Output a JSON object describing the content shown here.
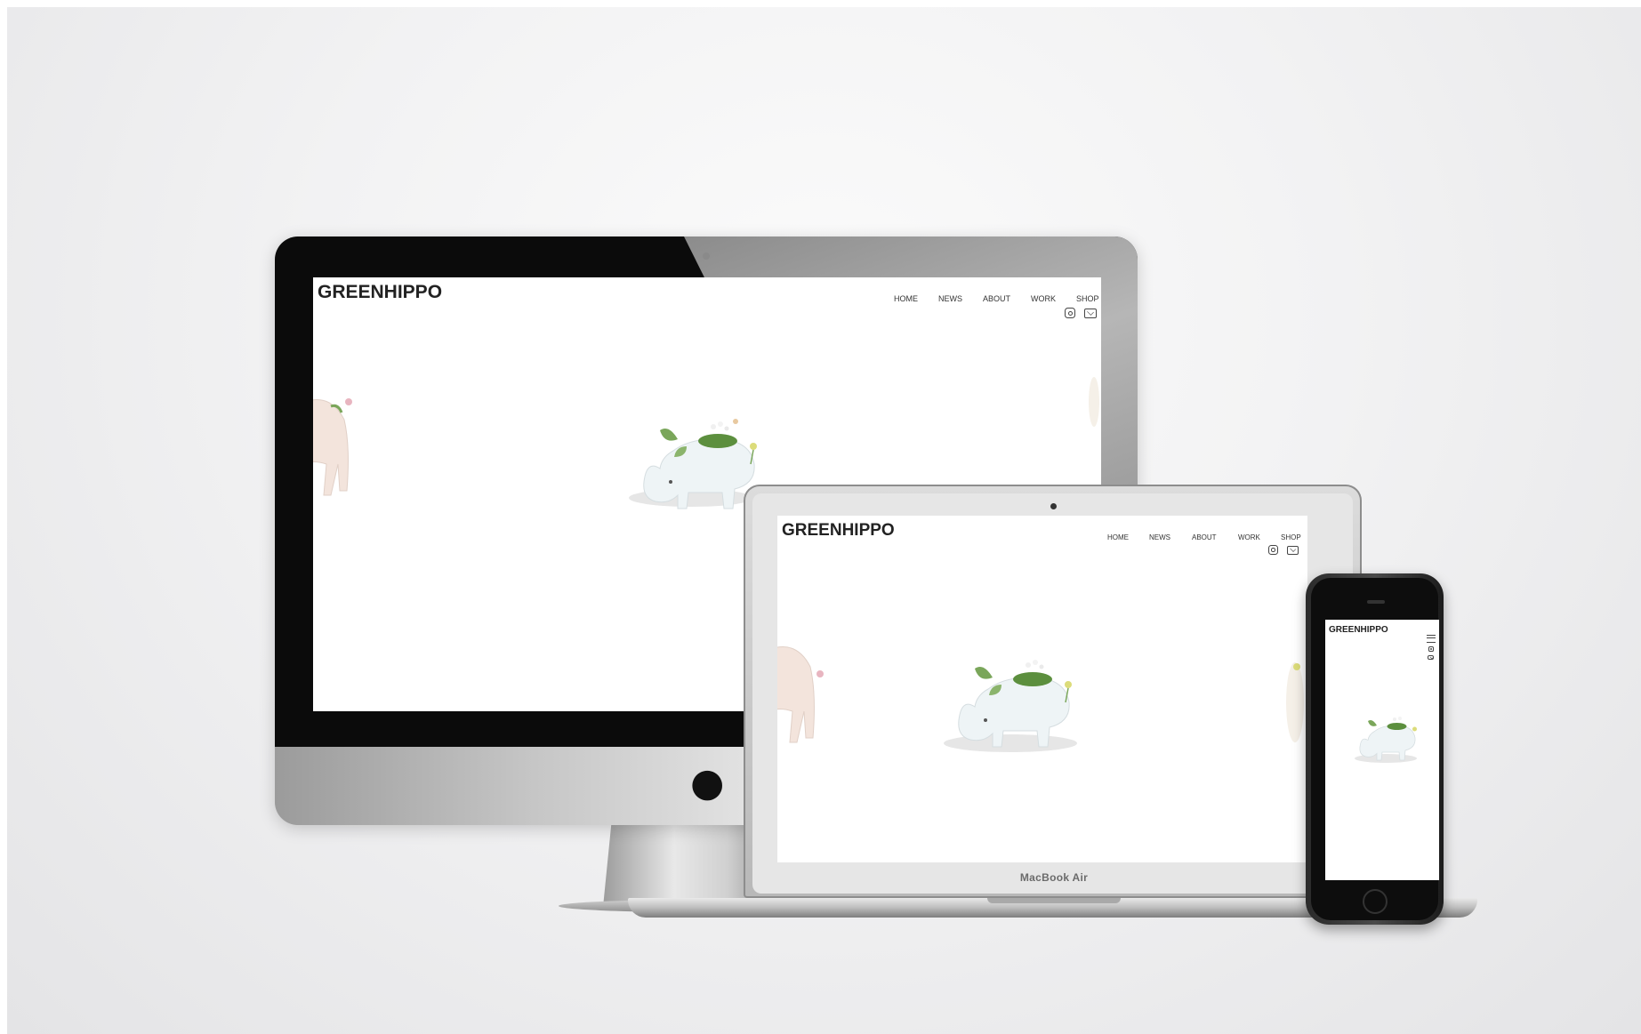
{
  "site": {
    "logo": "GREENHIPPO",
    "nav": [
      "HOME",
      "NEWS",
      "ABOUT",
      "WORK",
      "SHOP"
    ]
  },
  "devices": {
    "laptop_label": "MacBook Air"
  },
  "icons": {
    "social": [
      "instagram-icon",
      "mail-icon"
    ],
    "brand": "apple-logo-icon",
    "mobile_menu": "hamburger-menu-icon"
  },
  "colors": {
    "background": "#f2f2f3",
    "screen": "#ffffff",
    "logo_text": "#222222",
    "figure_white": "#eef3f5",
    "plant_green": "#6a9a4c"
  }
}
